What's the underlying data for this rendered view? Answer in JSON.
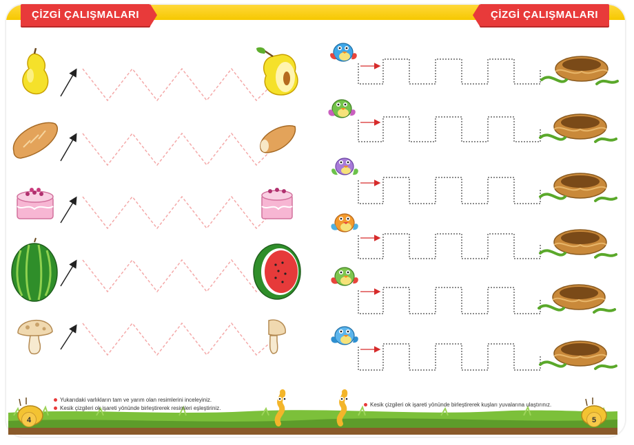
{
  "header": {
    "left_title": "ÇİZGİ ÇALIŞMALARI",
    "right_title": "ÇİZGİ ÇALIŞMALARI"
  },
  "left_page": {
    "rows": [
      {
        "whole": "pear-icon",
        "half": "half-pear-icon"
      },
      {
        "whole": "bread-icon",
        "half": "half-bread-icon"
      },
      {
        "whole": "cake-icon",
        "half": "half-cake-icon"
      },
      {
        "whole": "watermelon-icon",
        "half": "half-watermelon-icon"
      },
      {
        "whole": "mushroom-icon",
        "half": "half-mushroom-icon"
      }
    ],
    "instructions": [
      "Yukarıdaki varlıkların tam ve yarım olan resimlerini inceleyiniz.",
      "Kesik çizgileri ok işareti yönünde birleştirerek resimleri eşleştiriniz."
    ],
    "page_number": "4"
  },
  "right_page": {
    "rows": [
      {
        "bird": "blue-bird-icon",
        "nest": "nest-icon"
      },
      {
        "bird": "green-bird-icon",
        "nest": "nest-icon"
      },
      {
        "bird": "purple-bird-icon",
        "nest": "nest-icon"
      },
      {
        "bird": "orange-bird-icon",
        "nest": "nest-icon"
      },
      {
        "bird": "green-bird-icon",
        "nest": "nest-icon"
      },
      {
        "bird": "blue-bird-icon",
        "nest": "nest-icon"
      }
    ],
    "instruction": "Kesik çizgileri ok işareti yönünde birleştirerek kuşları yuvalarına ulaştırınız.",
    "page_number": "5"
  },
  "colors": {
    "ribbon": "#e83a3a",
    "zigzag": "#f4a8a8",
    "square_wave": "#444444",
    "grass": "#7cc03a"
  }
}
